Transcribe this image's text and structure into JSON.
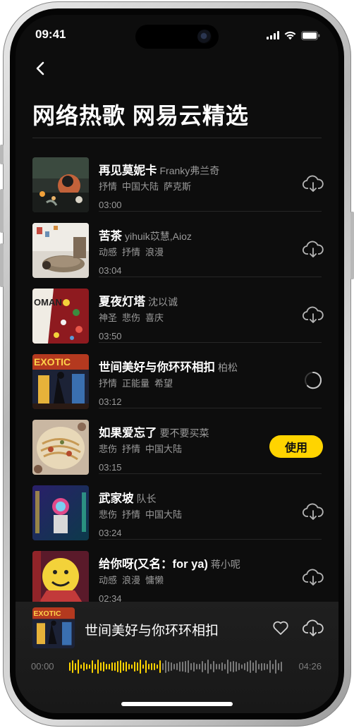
{
  "status": {
    "time": "09:41"
  },
  "header": {
    "title": "网络热歌 网易云精选"
  },
  "songs": [
    {
      "name": "再见莫妮卡",
      "artist": "Franky弗兰奇",
      "tags": [
        "抒情",
        "中国大陆",
        "萨克斯"
      ],
      "duration": "03:00",
      "state": "download"
    },
    {
      "name": "苦茶",
      "artist": "yihuik苡慧,Aioz",
      "tags": [
        "动感",
        "抒情",
        "浪漫"
      ],
      "duration": "03:04",
      "state": "download"
    },
    {
      "name": "夏夜灯塔",
      "artist": "沈以诚",
      "tags": [
        "神圣",
        "悲伤",
        "喜庆"
      ],
      "duration": "03:50",
      "state": "download"
    },
    {
      "name": "世间美好与你环环相扣",
      "artist": "柏松",
      "tags": [
        "抒情",
        "正能量",
        "希望"
      ],
      "duration": "03:12",
      "state": "loading"
    },
    {
      "name": "如果爱忘了",
      "artist": "要不要买菜",
      "tags": [
        "悲伤",
        "抒情",
        "中国大陆"
      ],
      "duration": "03:15",
      "state": "use"
    },
    {
      "name": "武家坡",
      "artist": "队长",
      "tags": [
        "悲伤",
        "抒情",
        "中国大陆"
      ],
      "duration": "03:24",
      "state": "download"
    },
    {
      "name": "给你呀(又名：for ya)",
      "artist": "蒋小呢",
      "tags": [
        "动感",
        "浪漫",
        "慵懒"
      ],
      "duration": "02:34",
      "state": "download"
    }
  ],
  "use_label": "使用",
  "player": {
    "title": "世间美好与你环环相扣",
    "elapsed": "00:00",
    "total": "04:26",
    "progress": 0.44
  },
  "colors": {
    "accent": "#ffd400",
    "background": "#0d0d0d",
    "muted": "#9a9a9a"
  },
  "icons": {
    "back": "chevron-left-icon",
    "download": "cloud-download-icon",
    "loading": "spinner-icon",
    "like": "heart-icon"
  }
}
